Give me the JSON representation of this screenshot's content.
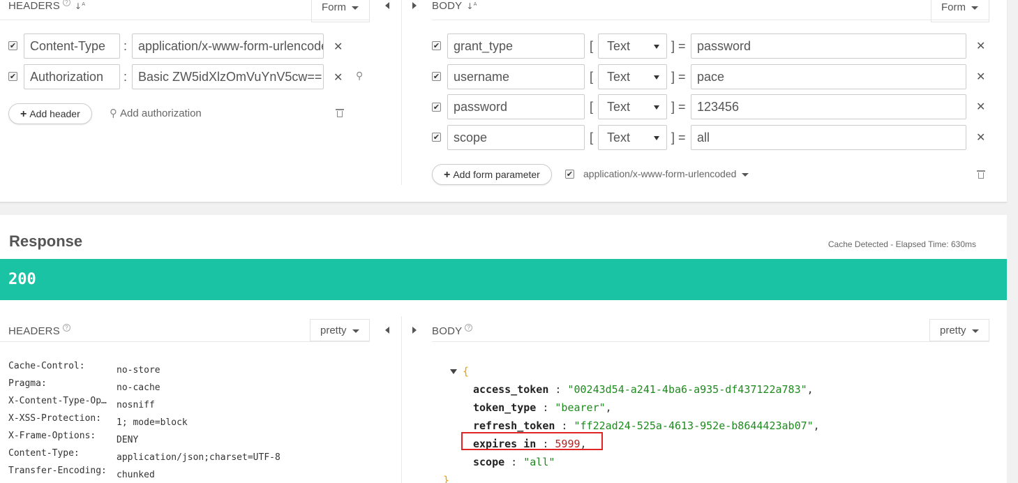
{
  "request": {
    "headers": {
      "title": "HEADERS",
      "help": "?",
      "sort": "↓",
      "sort_sup": "A",
      "sort_sub": "Z",
      "mode": "Form",
      "rows": [
        {
          "key": "Content-Type",
          "value": "application/x-www-form-urlencoded"
        },
        {
          "key": "Authorization",
          "value": "Basic ZW5idXlzOmVuYnV5cw=="
        }
      ],
      "add_header": "Add header",
      "add_authorization": "Add authorization"
    },
    "body": {
      "title": "BODY",
      "mode": "Form",
      "rows": [
        {
          "key": "grant_type",
          "type": "Text",
          "value": "password"
        },
        {
          "key": "username",
          "type": "Text",
          "value": "pace"
        },
        {
          "key": "password",
          "type": "Text",
          "value": "123456"
        },
        {
          "key": "scope",
          "type": "Text",
          "value": "all"
        }
      ],
      "add_param": "Add form parameter",
      "content_type": "application/x-www-form-urlencoded"
    }
  },
  "response": {
    "title": "Response",
    "elapsed": "Cache Detected - Elapsed Time: 630ms",
    "status": "200",
    "headers": {
      "title": "HEADERS",
      "mode": "pretty",
      "rows": [
        {
          "key": "Cache-Control:",
          "value": "no-store"
        },
        {
          "key": "Pragma:",
          "value": "no-cache"
        },
        {
          "key": "X-Content-Type-Op…",
          "value": "nosniff"
        },
        {
          "key": "X-XSS-Protection:",
          "value": "1; mode=block"
        },
        {
          "key": "X-Frame-Options:",
          "value": "DENY"
        },
        {
          "key": "Content-Type:",
          "value": "application/json;charset=UTF-8"
        },
        {
          "key": "Transfer-Encoding:",
          "value": "chunked"
        }
      ]
    },
    "body": {
      "title": "BODY",
      "mode": "pretty",
      "open_brace": "{",
      "close_brace": "}",
      "fields": [
        {
          "key": "access_token",
          "value": "\"00243d54-a241-4ba6-a935-df437122a783\"",
          "kind": "string"
        },
        {
          "key": "token_type",
          "value": "\"bearer\"",
          "kind": "string"
        },
        {
          "key": "refresh_token",
          "value": "\"ff22ad24-525a-4613-952e-b8644423ab07\"",
          "kind": "string"
        },
        {
          "key": "expires_in",
          "value": "5999",
          "kind": "number"
        },
        {
          "key": "scope",
          "value": "\"all\"",
          "kind": "string"
        }
      ]
    }
  },
  "colors": {
    "status_bar": "#19c3a3",
    "highlight": "#e02424",
    "json_string": "#1e8a1e",
    "json_number": "#b22222"
  }
}
